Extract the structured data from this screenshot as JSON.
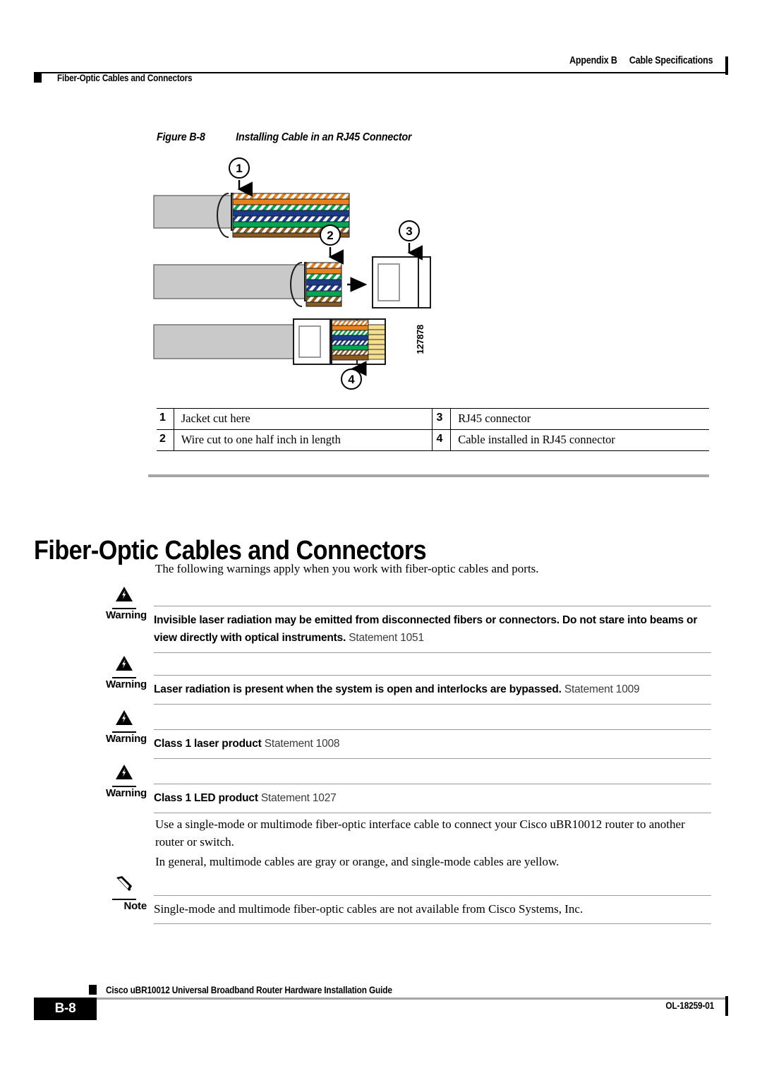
{
  "header": {
    "appendix": "Appendix B",
    "section": "Cable Specifications",
    "running_head": "Fiber-Optic Cables and Connectors"
  },
  "figure": {
    "number_label": "Figure B-8",
    "title": "Installing Cable in an RJ45 Connector",
    "art_id": "127878",
    "callouts": [
      "1",
      "2",
      "3",
      "4"
    ],
    "wire_colors": {
      "orange": "#E8801B",
      "green": "#00A651",
      "blue": "#1B3A8C",
      "brown": "#8B5A1E",
      "jacket_gray": "#C9C9C9",
      "contact_gold": "#F5DF8E",
      "white": "#FFFFFF",
      "outline": "#1A1A1A"
    }
  },
  "legend": {
    "rows": [
      {
        "left_num": "1",
        "left_text": "Jacket cut here",
        "right_num": "3",
        "right_text": "RJ45 connector"
      },
      {
        "left_num": "2",
        "left_text": "Wire cut to one half inch in length",
        "right_num": "4",
        "right_text": "Cable installed in RJ45 connector"
      }
    ]
  },
  "section": {
    "heading": "Fiber-Optic Cables and Connectors",
    "intro": "The following warnings apply when you work with fiber-optic cables and ports."
  },
  "warnings": [
    {
      "label": "Warning",
      "icon": "warning-triangle-icon",
      "text": "Invisible laser radiation may be emitted from disconnected fibers or connectors. Do not stare into beams or view directly with optical instruments.",
      "statement": "Statement 1051"
    },
    {
      "label": "Warning",
      "icon": "warning-triangle-icon",
      "text": "Laser radiation is present when the system is open and interlocks are bypassed.",
      "statement": "Statement 1009"
    },
    {
      "label": "Warning",
      "icon": "warning-triangle-icon",
      "text": "Class 1 laser product",
      "statement": "Statement 1008"
    },
    {
      "label": "Warning",
      "icon": "warning-triangle-icon",
      "text": "Class 1 LED product",
      "statement": "Statement 1027"
    }
  ],
  "body": {
    "para1": "Use a single-mode or multimode fiber-optic interface cable to connect your Cisco uBR10012 router to another router or switch.",
    "para2": "In general, multimode cables are gray or orange, and single-mode cables are yellow."
  },
  "note": {
    "label": "Note",
    "icon": "pencil-icon",
    "text": "Single-mode and multimode fiber-optic cables are not available from Cisco Systems, Inc."
  },
  "footer": {
    "title": "Cisco uBR10012 Universal Broadband Router Hardware Installation Guide",
    "page": "B-8",
    "doc_id": "OL-18259-01"
  }
}
